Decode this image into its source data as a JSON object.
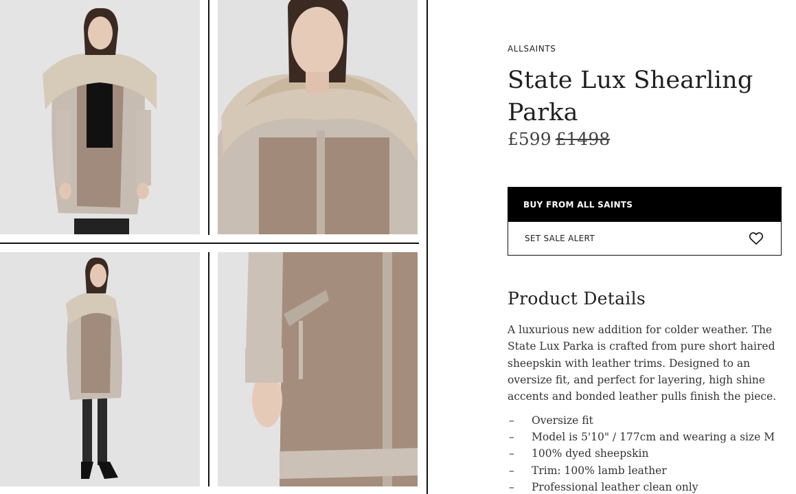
{
  "product": {
    "brand": "ALLSAINTS",
    "title": "State Lux Shearling Parka",
    "price_current": "£599",
    "price_original": "£1498"
  },
  "actions": {
    "buy_label": "BUY FROM ALL SAINTS",
    "alert_label": "SET SALE ALERT",
    "alert_icon": "heart-icon"
  },
  "details": {
    "heading": "Product Details",
    "description": "A luxurious new addition for colder weather. The State Lux Parka is crafted from pure short haired sheepskin with leather trims. Designed to an oversize fit, and perfect for layering, high shine accents and bonded leather pulls finish the piece.",
    "bullets": [
      "Oversize fit",
      "Model is 5'10\" / 177cm and wearing a size M",
      "100% dyed sheepskin",
      "Trim: 100% lamb leather",
      "Professional leather clean only"
    ],
    "bullet_marker": "–"
  },
  "gallery": {
    "colors": {
      "background": "#e6e6e6",
      "fur": "#a08b7c",
      "suede": "#c9bfb5",
      "collar": "#d8ccbc"
    }
  }
}
